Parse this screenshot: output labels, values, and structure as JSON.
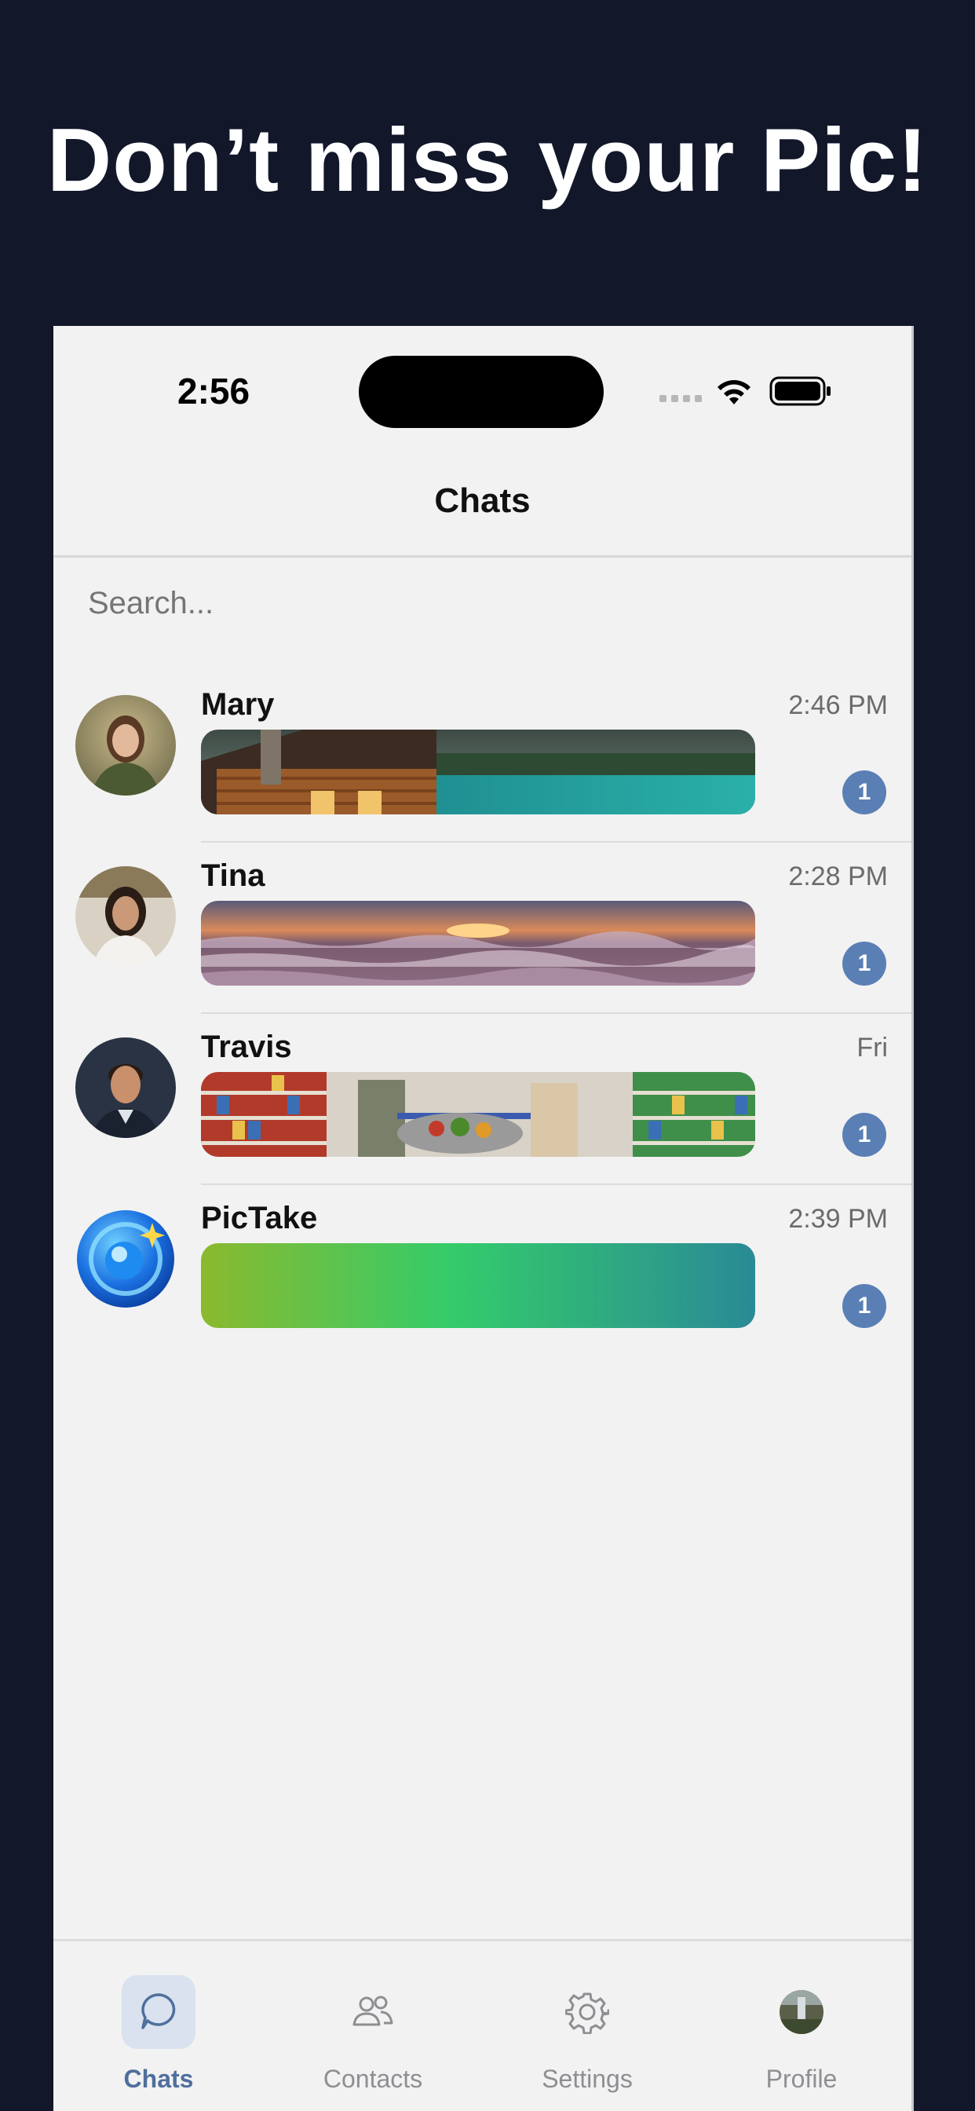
{
  "headline": "Don’t miss your Pic!",
  "status_bar": {
    "time": "2:56"
  },
  "header": {
    "title": "Chats"
  },
  "search": {
    "placeholder": "Search..."
  },
  "chats": [
    {
      "name": "Mary",
      "time": "2:46 PM",
      "unread": "1",
      "avatar": "woman-portrait",
      "preview": "cabin-lake-photo"
    },
    {
      "name": "Tina",
      "time": "2:28 PM",
      "unread": "1",
      "avatar": "woman-portrait",
      "preview": "ocean-sunset-photo"
    },
    {
      "name": "Travis",
      "time": "Fri",
      "unread": "1",
      "avatar": "man-portrait",
      "preview": "grocery-store-photo"
    },
    {
      "name": "PicTake",
      "time": "2:39 PM",
      "unread": "1",
      "avatar": "pictake-logo",
      "preview": "green-gradient"
    }
  ],
  "tabbar": {
    "items": [
      {
        "label": "Chats",
        "icon": "chat-bubble-icon",
        "active": true
      },
      {
        "label": "Contacts",
        "icon": "people-icon",
        "active": false
      },
      {
        "label": "Settings",
        "icon": "gear-icon",
        "active": false
      },
      {
        "label": "Profile",
        "icon": "avatar",
        "active": false
      }
    ]
  },
  "colors": {
    "background": "#12172a",
    "screen": "#f2f2f2",
    "badge": "#5a7fb5",
    "accent": "#4f6f9d"
  }
}
